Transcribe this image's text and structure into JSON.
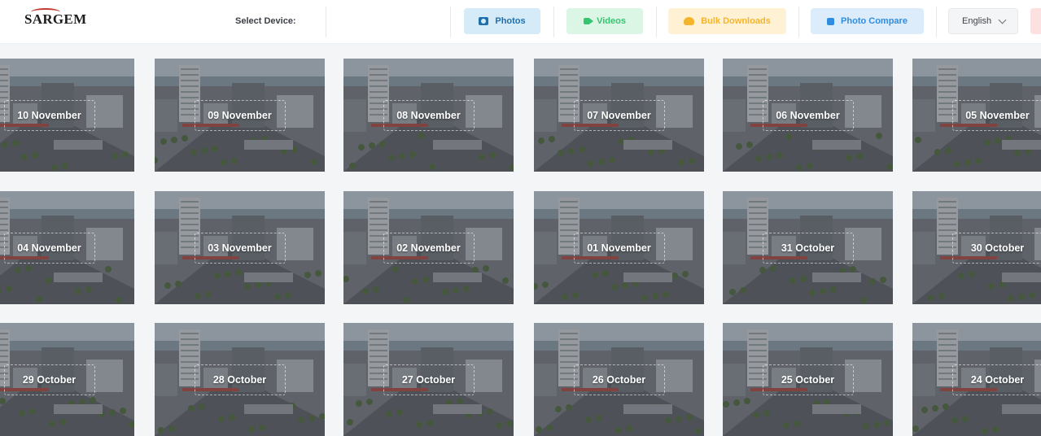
{
  "header": {
    "logo_text": "SARGEM",
    "select_device_label": "Select Device:",
    "nav": {
      "photos": "Photos",
      "videos": "Videos",
      "bulk_downloads": "Bulk Downloads",
      "photo_compare": "Photo Compare"
    },
    "language": "English",
    "colors": {
      "photos": "#1f6fae",
      "videos": "#35c46f",
      "bulk_downloads": "#f4b52c",
      "photo_compare": "#2f8ce0"
    }
  },
  "gallery": {
    "rows": [
      [
        "10 November",
        "09 November",
        "08 November",
        "07 November",
        "06 November",
        "05 November"
      ],
      [
        "04 November",
        "03 November",
        "02 November",
        "01 November",
        "31 October",
        "30 October"
      ],
      [
        "29 October",
        "28 October",
        "27 October",
        "26 October",
        "25 October",
        "24 October"
      ]
    ]
  }
}
